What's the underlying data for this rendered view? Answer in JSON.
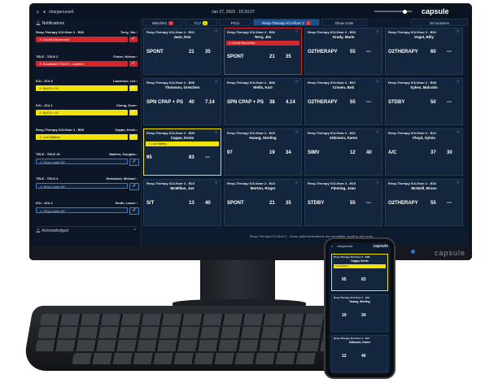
{
  "topbar": {
    "user": "chargenurse6",
    "datetime": "Jan 27, 2023 · 15:33:27",
    "logo": "capsule"
  },
  "sidebar": {
    "title": "Notifications",
    "items": [
      {
        "loc": "Resp-Therapy ICU-floor 2 - B02",
        "name": "Terry, Jim",
        "alarm": "Circuit Disconnect",
        "style": "red"
      },
      {
        "loc": "TELE - TELE 2",
        "name": "Fisher, Nelson",
        "alarm": "Sustained VTACH - Latched",
        "style": "red"
      },
      {
        "loc": "ICU - ICU 3",
        "name": "Lawrence, Lee",
        "alarm": "SpO2 < 91",
        "style": "yel"
      },
      {
        "loc": "ICU - ICU 1",
        "name": "Cheng, Dora",
        "alarm": "SpO2 < 91",
        "style": "yel"
      },
      {
        "loc": "Resp-Therapy ICU-floor 2 - B09",
        "name": "Capps, Kevin",
        "alarm": "Low Battery",
        "style": "yel"
      },
      {
        "loc": "TELE - TELE 15",
        "name": "Walters, Douglas",
        "alarm": "Reg Leads Off",
        "style": "blue"
      },
      {
        "loc": "TELE - TELE 4",
        "name": "Strickland, Michael",
        "alarm": "Reg Leads Off",
        "style": "blue"
      },
      {
        "loc": "ICU - ICU 2",
        "name": "Smith, Lance",
        "alarm": "Reg Leads Off",
        "style": "blue"
      }
    ],
    "acknowledged": "Acknowledged"
  },
  "tabs": [
    {
      "label": "Watchlist",
      "badge": "3",
      "badge_color": "red"
    },
    {
      "label": "ICU",
      "badge": "1",
      "badge_color": "yel"
    },
    {
      "label": "PICU",
      "badge": "",
      "badge_color": ""
    },
    {
      "label": "Resp-Therapy ICU-floor 2",
      "badge": "2",
      "badge_color": "red",
      "active": true
    },
    {
      "label": "Show Units",
      "badge": "",
      "badge_color": ""
    },
    {
      "label": "20 locations",
      "badge": "",
      "badge_color": ""
    }
  ],
  "cards": [
    {
      "loc": "Resp-Therapy ICU-floor 2 - B01",
      "name": "Jane, Doe",
      "alarm": "",
      "mode": "SPONT",
      "v1": "21",
      "v2": "35",
      "hl": ""
    },
    {
      "loc": "Resp-Therapy ICU-floor 2 - B02",
      "name": "Terry, Jim",
      "alarm": "Circuit Disconnect",
      "mode": "SPONT",
      "v1": "21",
      "v2": "35",
      "hl": "red"
    },
    {
      "loc": "Resp-Therapy ICU-floor 2 - B03",
      "name": "Grady, Marie",
      "alarm": "",
      "mode": "O2THERAPY",
      "v1": "55",
      "v2": "---",
      "hl": ""
    },
    {
      "loc": "Resp-Therapy ICU-floor 2 - B04",
      "name": "Vogel, Billy",
      "alarm": "",
      "mode": "O2THERAPY",
      "v1": "60",
      "v2": "---",
      "hl": ""
    },
    {
      "loc": "Resp-Therapy ICU-floor 2 - B05",
      "name": "Thomson, Gretchen",
      "alarm": "",
      "mode": "SPN CPAP + PS",
      "v1": "40",
      "v2": "7.14",
      "hl": ""
    },
    {
      "loc": "Resp-Therapy ICU-floor 2 - B06",
      "name": "Wells, Kurt",
      "alarm": "",
      "mode": "SPN CPAP + PS",
      "v1": "38",
      "v2": "4.14",
      "hl": ""
    },
    {
      "loc": "Resp-Therapy ICU-floor 2 - B07",
      "name": "Craven, Bob",
      "alarm": "",
      "mode": "O2THERAPY",
      "v1": "55",
      "v2": "---",
      "hl": ""
    },
    {
      "loc": "Resp-Therapy ICU-floor 2 - B08",
      "name": "Sykes, Malcolm",
      "alarm": "",
      "mode": "STDBY",
      "v1": "50",
      "v2": "---",
      "hl": ""
    },
    {
      "loc": "Resp-Therapy ICU-floor 2 - B09",
      "name": "Capps, Kevin",
      "alarm": "Low Battery",
      "mode": "95",
      "v1": "83",
      "v2": "---",
      "hl": "yel"
    },
    {
      "loc": "Resp-Therapy ICU-floor 2 - B10",
      "name": "Huang, Sterling",
      "alarm": "",
      "mode": "97",
      "v1": "19",
      "v2": "34",
      "hl": ""
    },
    {
      "loc": "Resp-Therapy ICU-floor 2 - B11",
      "name": "Atkinson, Karen",
      "alarm": "",
      "mode": "SIMV",
      "v1": "12",
      "v2": "40",
      "hl": ""
    },
    {
      "loc": "Resp-Therapy ICU-floor 2 - B12",
      "name": "Floyd, Sylvia",
      "alarm": "",
      "mode": "A/C",
      "v1": "37",
      "v2": "30",
      "hl": ""
    },
    {
      "loc": "Resp-Therapy ICU-floor 2 - B13",
      "name": "McMillan, Joe",
      "alarm": "",
      "mode": "S/T",
      "v1": "13",
      "v2": "40",
      "hl": ""
    },
    {
      "loc": "Resp-Therapy ICU-floor 2 - B14",
      "name": "Morton, Roger",
      "alarm": "",
      "mode": "SPONT",
      "v1": "21",
      "v2": "35",
      "hl": ""
    },
    {
      "loc": "Resp-Therapy ICU-floor 2 - B15",
      "name": "Fleming, Jean",
      "alarm": "",
      "mode": "STDBY",
      "v1": "55",
      "v2": "---",
      "hl": ""
    },
    {
      "loc": "Resp-Therapy ICU-floor 2 - B16",
      "name": "McNeill, Bruce",
      "alarm": "",
      "mode": "O2THERAPY",
      "v1": "55",
      "v2": "---",
      "hl": ""
    }
  ],
  "footer_msg": "Resp-Therapy ICU-floor 2 - Some patients/locations are not visible, scroll to see more.",
  "phone": {
    "user": "chargenurse",
    "cards": [
      {
        "loc": "Resp-Therapy ICU-floor 2 - B09",
        "name": "Capps, Kevin",
        "alarm": "Low Battery",
        "v1": "95",
        "v2": "83"
      },
      {
        "loc": "Resp-Therapy ICU-floor 2 - B10",
        "name": "Huang, Sterling",
        "alarm": "",
        "v1": "19",
        "v2": "34"
      },
      {
        "loc": "Resp-Therapy ICU-floor 2 - B11",
        "name": "Atkinson, Karen",
        "alarm": "",
        "v1": "12",
        "v2": "40"
      }
    ]
  }
}
